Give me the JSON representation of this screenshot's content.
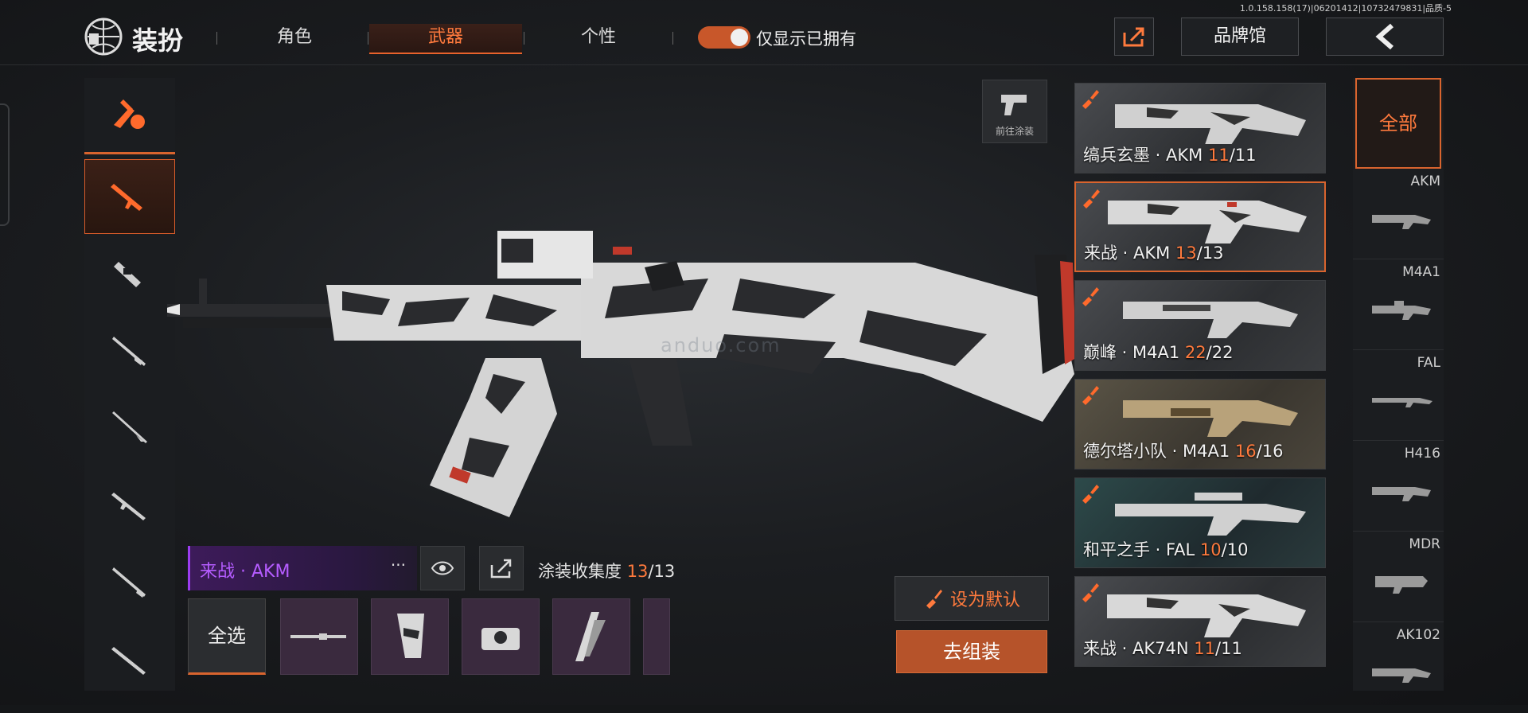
{
  "version": "1.0.158.158(17)|06201412|10732479831|品质-5",
  "header": {
    "title": "装扮",
    "tabs": [
      {
        "label": "角色"
      },
      {
        "label": "武器"
      },
      {
        "label": "个性"
      }
    ],
    "toggle_label": "仅显示已拥有",
    "brand_label": "品牌馆"
  },
  "goto_label": "前往涂装",
  "watermark": "anduo.com",
  "current": {
    "skin_name": "来战 · AKM",
    "more": "···",
    "collection_label": "涂装收集度",
    "collection_owned": "13",
    "collection_total": "/13"
  },
  "select_all": "全选",
  "set_default": "设为默认",
  "assemble": "去组装",
  "skins": [
    {
      "name": "缟兵玄墨 · AKM",
      "owned": "11",
      "total": "/11"
    },
    {
      "name": "来战 · AKM",
      "owned": "13",
      "total": "/13"
    },
    {
      "name": "巅峰 · M4A1",
      "owned": "22",
      "total": "/22"
    },
    {
      "name": "德尔塔小队 · M4A1",
      "owned": "16",
      "total": "/16"
    },
    {
      "name": "和平之手 · FAL",
      "owned": "10",
      "total": "/10"
    },
    {
      "name": "来战 · AK74N",
      "owned": "11",
      "total": "/11"
    }
  ],
  "filter": {
    "all": "全部",
    "items": [
      {
        "label": "AKM"
      },
      {
        "label": "M4A1"
      },
      {
        "label": "FAL"
      },
      {
        "label": "H416"
      },
      {
        "label": "MDR"
      },
      {
        "label": "AK102"
      }
    ]
  },
  "colors": {
    "accent": "#e8622c",
    "purple": "#b55cff"
  }
}
